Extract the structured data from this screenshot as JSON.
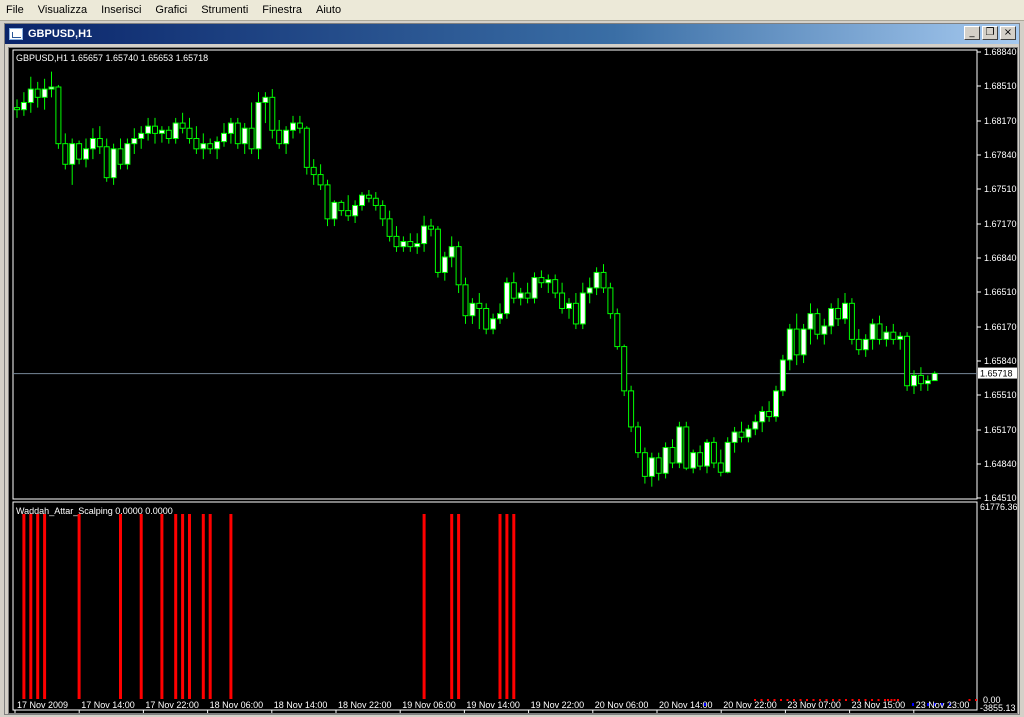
{
  "menu": [
    "File",
    "Visualizza",
    "Inserisci",
    "Grafici",
    "Strumenti",
    "Finestra",
    "Aiuto"
  ],
  "window": {
    "title": "GBPUSD,H1",
    "minimize_label": "_",
    "restore_label": "❐",
    "close_label": "×"
  },
  "main_chart": {
    "info": "GBPUSD,H1  1.65657  1.65740  1.65653  1.65718",
    "price_ticks": [
      "1.68840",
      "1.68510",
      "1.68170",
      "1.67840",
      "1.67510",
      "1.67170",
      "1.66840",
      "1.66510",
      "1.66170",
      "1.65840",
      "1.65510",
      "1.65170",
      "1.64840",
      "1.64510"
    ],
    "current_price": "1.65718",
    "bull_color": "#ffffff",
    "bear_color": "#000000",
    "wick_color": "#00ff00"
  },
  "indicator": {
    "info": "Waddah_Attar_Scalping 0.0000 0.0000",
    "max_label": "61776.36",
    "zero_label": "0.00",
    "min_label": "-3855.13",
    "bar_color": "#ff0000"
  },
  "time_axis": [
    "17 Nov 2009",
    "17 Nov 14:00",
    "17 Nov 22:00",
    "18 Nov 06:00",
    "18 Nov 14:00",
    "18 Nov 22:00",
    "19 Nov 06:00",
    "19 Nov 14:00",
    "19 Nov 22:00",
    "20 Nov 06:00",
    "20 Nov 14:00",
    "20 Nov 22:00",
    "23 Nov 07:00",
    "23 Nov 15:00",
    "23 Nov 23:00"
  ],
  "chart_data": {
    "type": "candlestick",
    "symbol": "GBPUSD",
    "timeframe": "H1",
    "price_range": [
      1.6451,
      1.6884
    ],
    "candles": [
      [
        1.683,
        1.6838,
        1.682,
        1.6828
      ],
      [
        1.6828,
        1.6845,
        1.6822,
        1.6835
      ],
      [
        1.6835,
        1.686,
        1.6825,
        1.6848
      ],
      [
        1.6848,
        1.6855,
        1.683,
        1.684
      ],
      [
        1.684,
        1.6858,
        1.6828,
        1.6848
      ],
      [
        1.6848,
        1.6865,
        1.684,
        1.685
      ],
      [
        1.685,
        1.6852,
        1.679,
        1.6795
      ],
      [
        1.6795,
        1.6805,
        1.677,
        1.6775
      ],
      [
        1.6775,
        1.68,
        1.6755,
        1.6795
      ],
      [
        1.6795,
        1.6798,
        1.6775,
        1.678
      ],
      [
        1.678,
        1.68,
        1.6772,
        1.679
      ],
      [
        1.679,
        1.681,
        1.678,
        1.68
      ],
      [
        1.68,
        1.6812,
        1.6785,
        1.6792
      ],
      [
        1.6792,
        1.68,
        1.6758,
        1.6762
      ],
      [
        1.6762,
        1.6795,
        1.6755,
        1.679
      ],
      [
        1.679,
        1.68,
        1.677,
        1.6775
      ],
      [
        1.6775,
        1.68,
        1.677,
        1.6795
      ],
      [
        1.6795,
        1.681,
        1.6785,
        1.68
      ],
      [
        1.68,
        1.6812,
        1.679,
        1.6805
      ],
      [
        1.6805,
        1.682,
        1.6798,
        1.6812
      ],
      [
        1.6812,
        1.682,
        1.6795,
        1.6805
      ],
      [
        1.6805,
        1.6812,
        1.6796,
        1.6808
      ],
      [
        1.6808,
        1.6812,
        1.6795,
        1.68
      ],
      [
        1.68,
        1.682,
        1.6795,
        1.6815
      ],
      [
        1.6815,
        1.6825,
        1.6805,
        1.681
      ],
      [
        1.681,
        1.682,
        1.6795,
        1.68
      ],
      [
        1.68,
        1.6812,
        1.6785,
        1.679
      ],
      [
        1.679,
        1.6805,
        1.678,
        1.6795
      ],
      [
        1.6795,
        1.68,
        1.6785,
        1.679
      ],
      [
        1.679,
        1.6802,
        1.678,
        1.6797
      ],
      [
        1.6797,
        1.6815,
        1.6792,
        1.6805
      ],
      [
        1.6805,
        1.682,
        1.6795,
        1.6815
      ],
      [
        1.6815,
        1.682,
        1.679,
        1.6795
      ],
      [
        1.6795,
        1.6815,
        1.6785,
        1.681
      ],
      [
        1.681,
        1.6835,
        1.6785,
        1.679
      ],
      [
        1.679,
        1.6845,
        1.678,
        1.6835
      ],
      [
        1.6835,
        1.6845,
        1.6815,
        1.684
      ],
      [
        1.684,
        1.6848,
        1.68,
        1.6808
      ],
      [
        1.6808,
        1.6818,
        1.679,
        1.6795
      ],
      [
        1.6795,
        1.6812,
        1.6785,
        1.6808
      ],
      [
        1.6808,
        1.6822,
        1.68,
        1.6815
      ],
      [
        1.6815,
        1.6822,
        1.6805,
        1.681
      ],
      [
        1.681,
        1.6812,
        1.6765,
        1.6772
      ],
      [
        1.6772,
        1.678,
        1.6755,
        1.6765
      ],
      [
        1.6765,
        1.6775,
        1.675,
        1.6755
      ],
      [
        1.6755,
        1.676,
        1.6715,
        1.6722
      ],
      [
        1.6722,
        1.674,
        1.6715,
        1.6738
      ],
      [
        1.6738,
        1.674,
        1.6725,
        1.673
      ],
      [
        1.673,
        1.6745,
        1.672,
        1.6725
      ],
      [
        1.6725,
        1.674,
        1.6718,
        1.6735
      ],
      [
        1.6735,
        1.6748,
        1.673,
        1.6745
      ],
      [
        1.6745,
        1.675,
        1.6738,
        1.6742
      ],
      [
        1.6742,
        1.6748,
        1.673,
        1.6735
      ],
      [
        1.6735,
        1.674,
        1.6715,
        1.6722
      ],
      [
        1.6722,
        1.673,
        1.67,
        1.6705
      ],
      [
        1.6705,
        1.6715,
        1.669,
        1.6695
      ],
      [
        1.6695,
        1.6705,
        1.669,
        1.67
      ],
      [
        1.67,
        1.6708,
        1.669,
        1.6695
      ],
      [
        1.6695,
        1.6708,
        1.6688,
        1.6698
      ],
      [
        1.6698,
        1.6725,
        1.669,
        1.6715
      ],
      [
        1.6715,
        1.6722,
        1.6705,
        1.6712
      ],
      [
        1.6712,
        1.6715,
        1.6665,
        1.667
      ],
      [
        1.667,
        1.669,
        1.6662,
        1.6685
      ],
      [
        1.6685,
        1.6705,
        1.6675,
        1.6695
      ],
      [
        1.6695,
        1.67,
        1.665,
        1.6658
      ],
      [
        1.6658,
        1.6665,
        1.662,
        1.6628
      ],
      [
        1.6628,
        1.6645,
        1.662,
        1.664
      ],
      [
        1.664,
        1.665,
        1.6615,
        1.6635
      ],
      [
        1.6635,
        1.664,
        1.661,
        1.6615
      ],
      [
        1.6615,
        1.663,
        1.661,
        1.6625
      ],
      [
        1.6625,
        1.664,
        1.662,
        1.663
      ],
      [
        1.663,
        1.6665,
        1.6625,
        1.666
      ],
      [
        1.666,
        1.667,
        1.664,
        1.6645
      ],
      [
        1.6645,
        1.6655,
        1.6638,
        1.665
      ],
      [
        1.665,
        1.666,
        1.664,
        1.6645
      ],
      [
        1.6645,
        1.667,
        1.664,
        1.6665
      ],
      [
        1.6665,
        1.6672,
        1.6655,
        1.666
      ],
      [
        1.666,
        1.6668,
        1.665,
        1.6663
      ],
      [
        1.6663,
        1.6668,
        1.6645,
        1.665
      ],
      [
        1.665,
        1.666,
        1.663,
        1.6635
      ],
      [
        1.6635,
        1.6645,
        1.6625,
        1.664
      ],
      [
        1.664,
        1.665,
        1.6615,
        1.662
      ],
      [
        1.662,
        1.666,
        1.6615,
        1.665
      ],
      [
        1.665,
        1.6665,
        1.664,
        1.6655
      ],
      [
        1.6655,
        1.6675,
        1.6648,
        1.667
      ],
      [
        1.667,
        1.6678,
        1.665,
        1.6655
      ],
      [
        1.6655,
        1.666,
        1.6625,
        1.663
      ],
      [
        1.663,
        1.6635,
        1.6595,
        1.6598
      ],
      [
        1.6598,
        1.66,
        1.655,
        1.6555
      ],
      [
        1.6555,
        1.656,
        1.6515,
        1.652
      ],
      [
        1.652,
        1.6525,
        1.649,
        1.6495
      ],
      [
        1.6495,
        1.65,
        1.6465,
        1.6472
      ],
      [
        1.6472,
        1.6495,
        1.6462,
        1.649
      ],
      [
        1.649,
        1.6495,
        1.6468,
        1.6475
      ],
      [
        1.6475,
        1.6505,
        1.647,
        1.65
      ],
      [
        1.65,
        1.6508,
        1.648,
        1.6485
      ],
      [
        1.6485,
        1.6525,
        1.648,
        1.652
      ],
      [
        1.652,
        1.6525,
        1.6478,
        1.648
      ],
      [
        1.648,
        1.6498,
        1.6475,
        1.6495
      ],
      [
        1.6495,
        1.6502,
        1.6478,
        1.6482
      ],
      [
        1.6482,
        1.6508,
        1.6475,
        1.6505
      ],
      [
        1.6505,
        1.651,
        1.648,
        1.6485
      ],
      [
        1.6485,
        1.6498,
        1.6472,
        1.6476
      ],
      [
        1.6476,
        1.651,
        1.6475,
        1.6505
      ],
      [
        1.6505,
        1.652,
        1.6495,
        1.6515
      ],
      [
        1.6515,
        1.6525,
        1.6505,
        1.651
      ],
      [
        1.651,
        1.6522,
        1.6505,
        1.6518
      ],
      [
        1.6518,
        1.6532,
        1.6512,
        1.6525
      ],
      [
        1.6525,
        1.654,
        1.6515,
        1.6535
      ],
      [
        1.6535,
        1.6545,
        1.6525,
        1.653
      ],
      [
        1.653,
        1.656,
        1.6525,
        1.6555
      ],
      [
        1.6555,
        1.659,
        1.655,
        1.6585
      ],
      [
        1.6585,
        1.662,
        1.6575,
        1.6615
      ],
      [
        1.6615,
        1.663,
        1.658,
        1.659
      ],
      [
        1.659,
        1.662,
        1.6582,
        1.6615
      ],
      [
        1.6615,
        1.664,
        1.66,
        1.663
      ],
      [
        1.663,
        1.6635,
        1.6605,
        1.661
      ],
      [
        1.661,
        1.6625,
        1.66,
        1.6618
      ],
      [
        1.6618,
        1.664,
        1.661,
        1.6635
      ],
      [
        1.6635,
        1.6645,
        1.6618,
        1.6625
      ],
      [
        1.6625,
        1.665,
        1.662,
        1.664
      ],
      [
        1.664,
        1.6645,
        1.66,
        1.6605
      ],
      [
        1.6605,
        1.6615,
        1.659,
        1.6595
      ],
      [
        1.6595,
        1.661,
        1.6588,
        1.6605
      ],
      [
        1.6605,
        1.6625,
        1.6595,
        1.662
      ],
      [
        1.662,
        1.6628,
        1.66,
        1.6605
      ],
      [
        1.6605,
        1.6618,
        1.6598,
        1.6612
      ],
      [
        1.6612,
        1.662,
        1.66,
        1.6605
      ],
      [
        1.6605,
        1.6612,
        1.6595,
        1.6608
      ],
      [
        1.6608,
        1.6612,
        1.6555,
        1.656
      ],
      [
        1.656,
        1.6575,
        1.6552,
        1.657
      ],
      [
        1.657,
        1.6578,
        1.6555,
        1.6562
      ],
      [
        1.6562,
        1.657,
        1.6555,
        1.6565
      ],
      [
        1.6565,
        1.6574,
        1.6565,
        1.6572
      ]
    ],
    "indicator_spikes": [
      1,
      2,
      3,
      4,
      9,
      15,
      18,
      21,
      23,
      24,
      25,
      27,
      28,
      31,
      59,
      63,
      64,
      70,
      71,
      72
    ]
  }
}
